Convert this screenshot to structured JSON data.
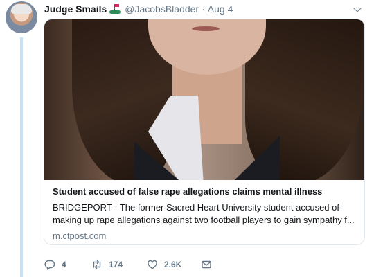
{
  "tweet": {
    "author_name": "Judge Smails",
    "author_emoji": "golf-flag-emoji",
    "handle": "@JacobsBladder",
    "separator": "·",
    "date": "Aug 4"
  },
  "card": {
    "title": "Student accused of false rape allegations claims mental illness",
    "description": "BRIDGEPORT - The former Sacred Heart University student accused of making up rape allegations against two football players to gain sympathy f...",
    "domain": "m.ctpost.com"
  },
  "actions": {
    "reply_count": "4",
    "retweet_count": "174",
    "like_count": "2.6K"
  },
  "colors": {
    "thread_line": "#c4e1f5",
    "meta_text": "#657786",
    "border": "#e1e8ed"
  }
}
